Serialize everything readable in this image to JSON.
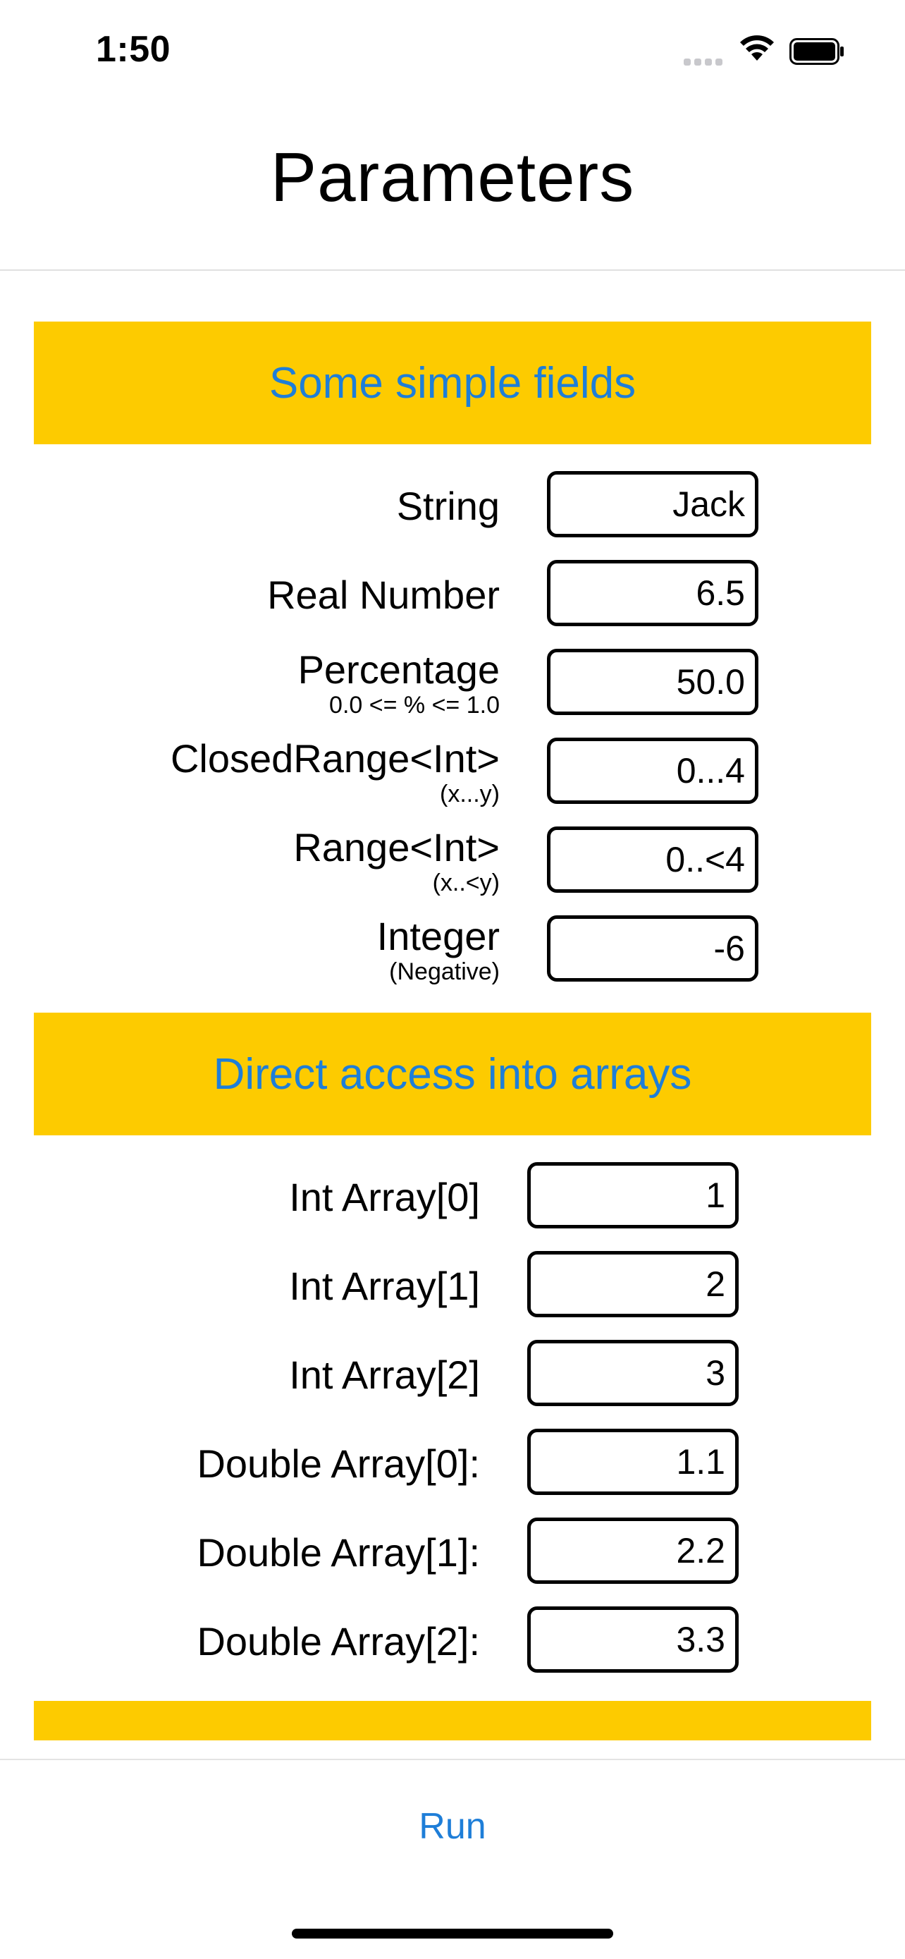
{
  "status_bar": {
    "time": "1:50"
  },
  "nav": {
    "title": "Parameters"
  },
  "sections": [
    {
      "title": "Some simple fields",
      "rows": [
        {
          "label": "String",
          "hint": "",
          "value": "Jack"
        },
        {
          "label": "Real Number",
          "hint": "",
          "value": "6.5"
        },
        {
          "label": "Percentage",
          "hint": "0.0 <= % <= 1.0",
          "value": "50.0"
        },
        {
          "label": "ClosedRange<Int>",
          "hint": "(x...y)",
          "value": "0...4"
        },
        {
          "label": "Range<Int>",
          "hint": "(x..<y)",
          "value": "0..<4"
        },
        {
          "label": "Integer",
          "hint": "(Negative)",
          "value": "-6"
        }
      ]
    },
    {
      "title": "Direct access into arrays",
      "rows": [
        {
          "label": "Int Array[0]",
          "value": "1"
        },
        {
          "label": "Int Array[1]",
          "value": "2"
        },
        {
          "label": "Int Array[2]",
          "value": "3"
        },
        {
          "label": "Double Array[0]:",
          "value": "1.1"
        },
        {
          "label": "Double Array[1]:",
          "value": "2.2"
        },
        {
          "label": "Double Array[2]:",
          "value": "3.3"
        }
      ]
    }
  ],
  "footer": {
    "run_label": "Run"
  },
  "colors": {
    "section_background": "#fdcb00",
    "accent_blue": "#1e7ed8"
  },
  "icons": [
    "cellular-signal-icon",
    "wifi-icon",
    "battery-icon"
  ]
}
